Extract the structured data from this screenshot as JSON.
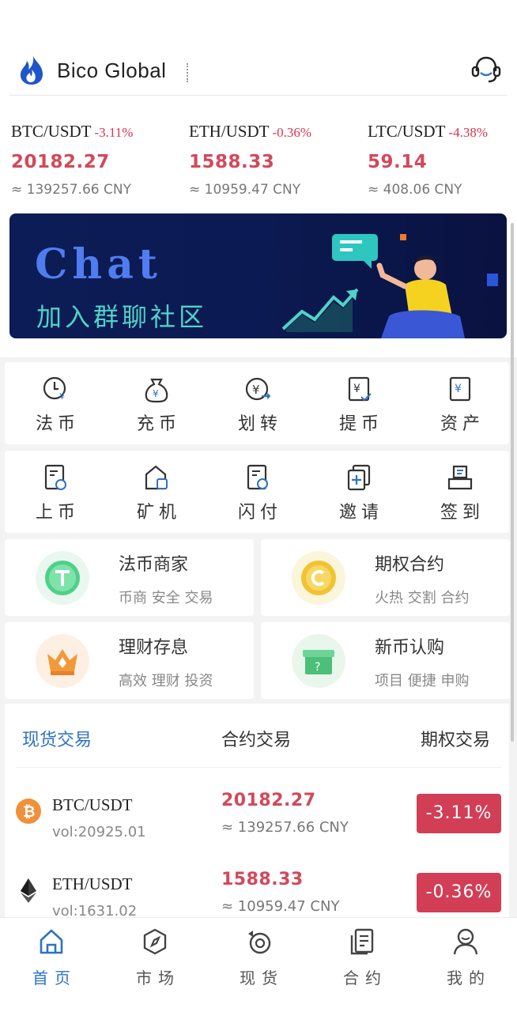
{
  "header": {
    "brand": "Bico Global"
  },
  "tickers": [
    {
      "pair": "BTC/USDT",
      "change": "-3.11%",
      "price": "20182.27",
      "cny": "≈ 139257.66 CNY"
    },
    {
      "pair": "ETH/USDT",
      "change": "-0.36%",
      "price": "1588.33",
      "cny": "≈ 10959.47 CNY"
    },
    {
      "pair": "LTC/USDT",
      "change": "-4.38%",
      "price": "59.14",
      "cny": "≈ 408.06 CNY"
    }
  ],
  "banner": {
    "title": "Chat",
    "subtitle": "加入群聊社区"
  },
  "grid_row1": [
    {
      "label": "法币",
      "icon": "clock-yen-icon"
    },
    {
      "label": "充币",
      "icon": "money-bag-icon"
    },
    {
      "label": "划转",
      "icon": "yen-transfer-icon"
    },
    {
      "label": "提币",
      "icon": "withdraw-receipt-icon"
    },
    {
      "label": "资产",
      "icon": "asset-doc-icon"
    }
  ],
  "grid_row2": [
    {
      "label": "上币",
      "icon": "list-coin-icon"
    },
    {
      "label": "矿机",
      "icon": "mining-machine-icon"
    },
    {
      "label": "闪付",
      "icon": "flash-pay-icon"
    },
    {
      "label": "邀请",
      "icon": "invite-icon"
    },
    {
      "label": "签到",
      "icon": "check-in-icon"
    }
  ],
  "features": [
    {
      "title": "法币商家",
      "subtitle": "币商 安全 交易",
      "icon": "tether-coin-icon"
    },
    {
      "title": "期权合约",
      "subtitle": "火热 交割 合约",
      "icon": "gold-coin-icon"
    },
    {
      "title": "理财存息",
      "subtitle": "高效 理财 投资",
      "icon": "crown-icon"
    },
    {
      "title": "新币认购",
      "subtitle": "项目 便捷 申购",
      "icon": "gift-box-icon"
    }
  ],
  "market": {
    "tabs": [
      "现货交易",
      "合约交易",
      "期权交易"
    ],
    "active_tab": 0,
    "rows": [
      {
        "pair": "BTC/USDT",
        "vol": "vol:20925.01",
        "price": "20182.27",
        "cny": "≈ 139257.66 CNY",
        "change": "-3.11%",
        "icon": "bitcoin-icon"
      },
      {
        "pair": "ETH/USDT",
        "vol": "vol:1631.02",
        "price": "1588.33",
        "cny": "≈ 10959.47 CNY",
        "change": "-0.36%",
        "icon": "ethereum-icon"
      }
    ]
  },
  "nav": [
    {
      "label": "首页",
      "icon": "home-icon",
      "active": true
    },
    {
      "label": "市场",
      "icon": "compass-icon",
      "active": false
    },
    {
      "label": "现货",
      "icon": "spot-icon",
      "active": false
    },
    {
      "label": "合约",
      "icon": "contract-icon",
      "active": false
    },
    {
      "label": "我的",
      "icon": "profile-icon",
      "active": false
    }
  ],
  "colors": {
    "accent": "#2f72c4",
    "down": "#d3485a",
    "badge": "#d23e56",
    "banner_bg": "#0c1c56"
  }
}
